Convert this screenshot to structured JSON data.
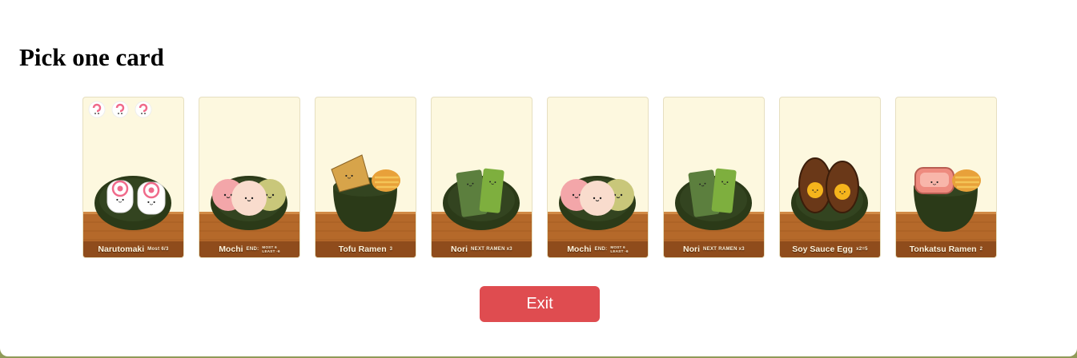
{
  "dialog": {
    "title": "Pick one card",
    "exit_label": "Exit"
  },
  "cards": [
    {
      "name": "Narutomaki",
      "rule": "Most 6/3",
      "rule_lines": [],
      "art": "narutomaki-icon",
      "badges": 3
    },
    {
      "name": "Mochi",
      "rule": "END:",
      "rule_lines": [
        "MOST 6",
        "LEAST -6"
      ],
      "art": "mochi-icon",
      "badges": 0
    },
    {
      "name": "Tofu Ramen",
      "rule": "3",
      "rule_lines": [],
      "art": "tofu-ramen-icon",
      "badges": 0
    },
    {
      "name": "Nori",
      "rule": "NEXT RAMEN x3",
      "rule_lines": [],
      "art": "nori-icon",
      "badges": 0
    },
    {
      "name": "Mochi",
      "rule": "END:",
      "rule_lines": [
        "MOST 6",
        "LEAST -6"
      ],
      "art": "mochi-icon",
      "badges": 0
    },
    {
      "name": "Nori",
      "rule": "NEXT RAMEN x3",
      "rule_lines": [],
      "art": "nori-icon",
      "badges": 0
    },
    {
      "name": "Soy Sauce Egg",
      "rule": "x2=5",
      "rule_lines": [],
      "art": "soy-sauce-egg-icon",
      "badges": 0
    },
    {
      "name": "Tonkatsu Ramen",
      "rule": "2",
      "rule_lines": [],
      "art": "tonkatsu-ramen-icon",
      "badges": 0
    }
  ],
  "colors": {
    "card_bg": "#fdf8df",
    "table_wood": "#b5692a",
    "bowl": "#2b3a18",
    "button": "#df4c50",
    "page_edge": "#8f9a58"
  }
}
